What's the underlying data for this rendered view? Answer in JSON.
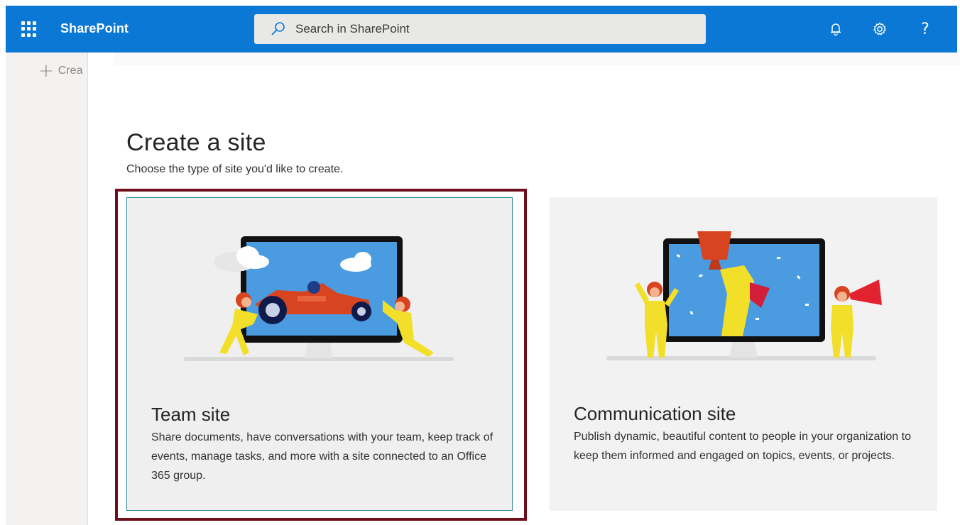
{
  "header": {
    "brand": "SharePoint",
    "search_placeholder": "Search in SharePoint",
    "icons": [
      "app-launcher-icon",
      "bell-icon",
      "gear-icon",
      "help-icon"
    ],
    "help_glyph": "?",
    "accent_color": "#0a78d4"
  },
  "leftnav": {
    "create_label": "Crea"
  },
  "main": {
    "title": "Create a site",
    "subtitle": "Choose the type of site you'd like to create."
  },
  "cards": {
    "team": {
      "title": "Team site",
      "description": "Share documents, have conversations with your team, keep track of events, manage tasks, and more with a site connected to an Office 365 group.",
      "selected": true,
      "selection_color": "#6e0f1b"
    },
    "communication": {
      "title": "Communication site",
      "description": "Publish dynamic, beautiful content to people in your organization to keep them informed and engaged on topics, events, or projects."
    }
  }
}
